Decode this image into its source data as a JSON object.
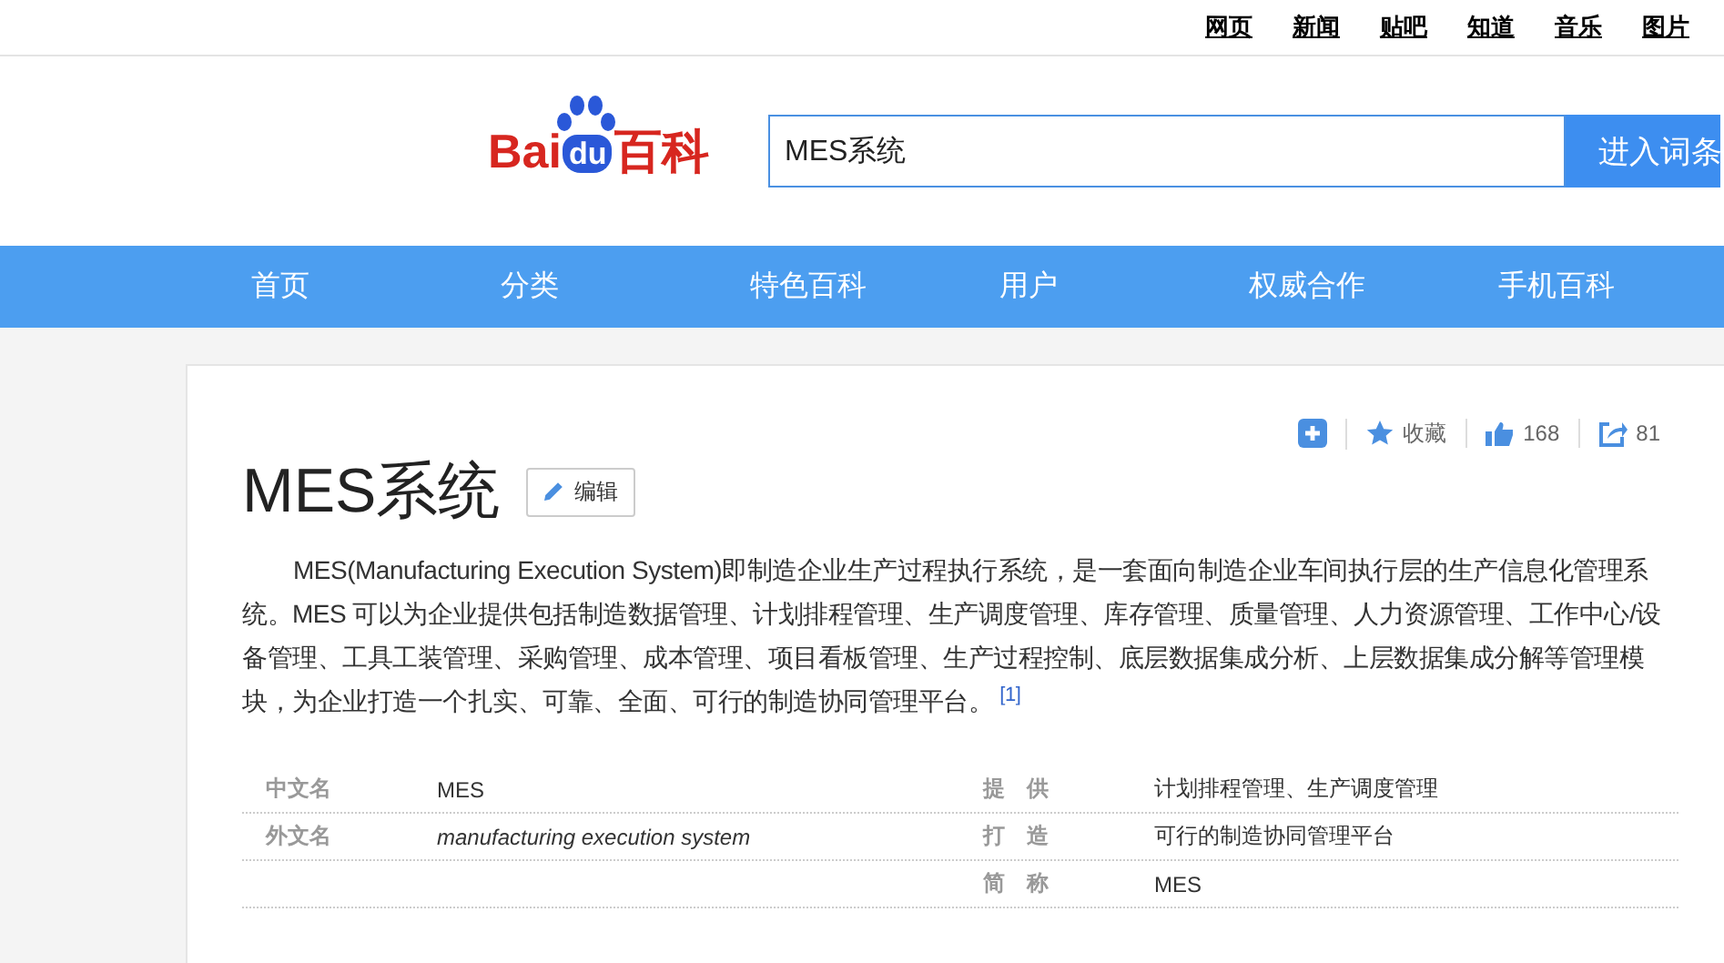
{
  "top_links": [
    "网页",
    "新闻",
    "贴吧",
    "知道",
    "音乐",
    "图片"
  ],
  "logo": {
    "left": "Bai",
    "paw": "du",
    "right": "百科"
  },
  "search": {
    "value": "MES系统",
    "button": "进入词条"
  },
  "nav": [
    "首页",
    "分类",
    "特色百科",
    "用户",
    "权威合作",
    "手机百科"
  ],
  "article": {
    "title": "MES系统",
    "edit": "编辑",
    "actions": [
      {
        "kind": "add"
      },
      {
        "kind": "star",
        "label": "收藏"
      },
      {
        "kind": "like",
        "label": "168"
      },
      {
        "kind": "share",
        "label": "81"
      }
    ],
    "summary": "MES(Manufacturing Execution System)即制造企业生产过程执行系统，是一套面向制造企业车间执行层的生产信息化管理系统。MES 可以为企业提供包括制造数据管理、计划排程管理、生产调度管理、库存管理、质量管理、人力资源管理、工作中心/设备管理、工具工装管理、采购管理、成本管理、项目看板管理、生产过程控制、底层数据集成分析、上层数据集成分解等管理模块，为企业打造一个扎实、可靠、全面、可行的制造协同管理平台。",
    "reference": "[1]",
    "info": [
      {
        "left": {
          "label": "中文名",
          "value": "MES",
          "italic": false
        },
        "right": {
          "label": "提　供",
          "value": "计划排程管理、生产调度管理",
          "italic": false
        }
      },
      {
        "left": {
          "label": "外文名",
          "value": "manufacturing execution system",
          "italic": true
        },
        "right": {
          "label": "打　造",
          "value": "可行的制造协同管理平台",
          "italic": false
        }
      },
      {
        "right": {
          "label": "简　称",
          "value": "MES",
          "italic": false
        }
      }
    ]
  }
}
